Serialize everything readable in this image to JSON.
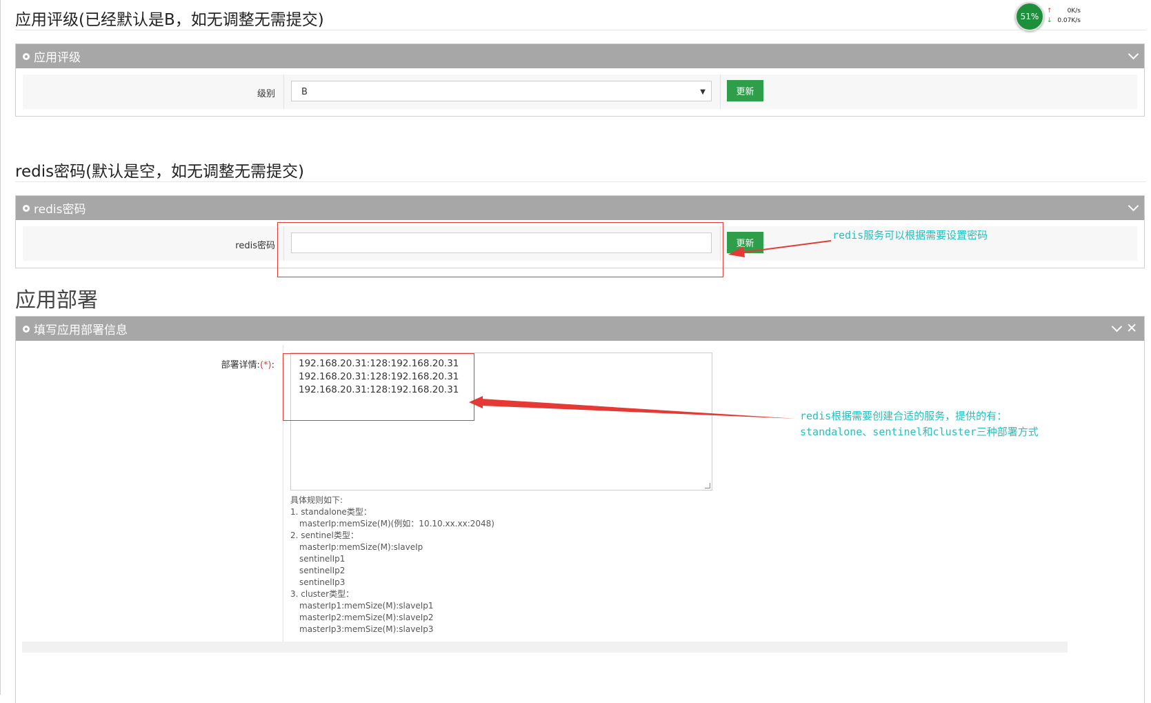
{
  "rating_section": {
    "heading": "应用评级(已经默认是B，如无调整无需提交)",
    "panel_title": "应用评级",
    "level_label": "级别",
    "level_value": "B",
    "update_button": "更新"
  },
  "password_section": {
    "heading": "redis密码(默认是空，如无调整无需提交)",
    "panel_title": "redis密码",
    "password_label": "redis密码",
    "password_value": "",
    "update_button": "更新",
    "annotation": "redis服务可以根据需要设置密码"
  },
  "deploy_section": {
    "heading": "应用部署",
    "panel_title": "填写应用部署信息",
    "detail_label": "部署详情:",
    "required_mark": "(*)",
    "detail_suffix": ":",
    "detail_lines": [
      "192.168.20.31:128:192.168.20.31",
      "192.168.20.31:128:192.168.20.31",
      "192.168.20.31:128:192.168.20.31"
    ],
    "rules": [
      {
        "text": "具体规则如下:",
        "indent": false
      },
      {
        "text": "1. standalone类型：",
        "indent": false
      },
      {
        "text": "masterIp:memSize(M)(例如：10.10.xx.xx:2048)",
        "indent": true
      },
      {
        "text": "2. sentinel类型：",
        "indent": false
      },
      {
        "text": "masterIp:memSize(M):slaveIp",
        "indent": true
      },
      {
        "text": "sentinelIp1",
        "indent": true
      },
      {
        "text": "sentinelIp2",
        "indent": true
      },
      {
        "text": "sentinelIp3",
        "indent": true
      },
      {
        "text": "3. cluster类型：",
        "indent": false
      },
      {
        "text": "masterIp1:memSize(M):slaveIp1",
        "indent": true
      },
      {
        "text": "masterIp2:memSize(M):slaveIp2",
        "indent": true
      },
      {
        "text": "masterIp3:memSize(M):slaveIp3",
        "indent": true
      }
    ],
    "annotation_lines": [
      "redis根据需要创建合适的服务，提供的有：",
      "standalone、sentinel和cluster三种部署方式"
    ]
  },
  "network_widget": {
    "usage": "51%",
    "up_speed": "0K/s",
    "down_speed": "0.07K/s",
    "up_icon": "arrow-up-icon",
    "down_icon": "arrow-down-icon"
  },
  "colors": {
    "panel_header": "#a7a7a7",
    "button_green": "#2e9e4a",
    "annotation_cyan": "#22c0c0",
    "highlight_red": "#e53935"
  }
}
